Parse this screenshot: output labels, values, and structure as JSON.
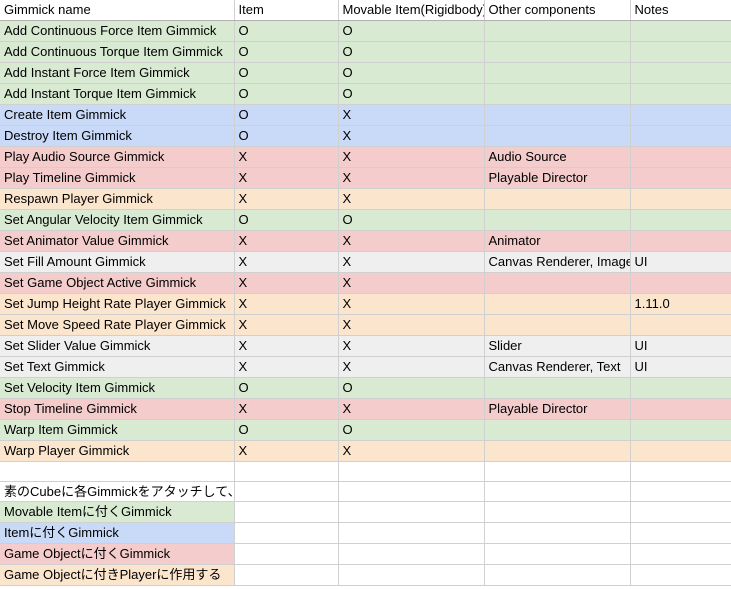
{
  "table": {
    "columns": [
      {
        "key": "gimmick_name",
        "label": "Gimmick name"
      },
      {
        "key": "item",
        "label": "Item"
      },
      {
        "key": "movable_item",
        "label": "Movable Item(Rigidbody)"
      },
      {
        "key": "other_components",
        "label": "Other components"
      },
      {
        "key": "notes",
        "label": "Notes"
      }
    ],
    "rows": [
      {
        "gimmick_name": "Add Continuous Force Item Gimmick",
        "item": "O",
        "movable_item": "O",
        "other_components": "",
        "notes": "",
        "fill": "green"
      },
      {
        "gimmick_name": "Add Continuous Torque Item Gimmick",
        "item": "O",
        "movable_item": "O",
        "other_components": "",
        "notes": "",
        "fill": "green"
      },
      {
        "gimmick_name": "Add Instant Force Item Gimmick",
        "item": "O",
        "movable_item": "O",
        "other_components": "",
        "notes": "",
        "fill": "green"
      },
      {
        "gimmick_name": "Add Instant Torque Item Gimmick",
        "item": "O",
        "movable_item": "O",
        "other_components": "",
        "notes": "",
        "fill": "green"
      },
      {
        "gimmick_name": "Create Item Gimmick",
        "item": "O",
        "movable_item": "X",
        "other_components": "",
        "notes": "",
        "fill": "blue"
      },
      {
        "gimmick_name": "Destroy Item Gimmick",
        "item": "O",
        "movable_item": "X",
        "other_components": "",
        "notes": "",
        "fill": "blue"
      },
      {
        "gimmick_name": "Play Audio Source Gimmick",
        "item": "X",
        "movable_item": "X",
        "other_components": "Audio Source",
        "notes": "",
        "fill": "pink"
      },
      {
        "gimmick_name": "Play Timeline Gimmick",
        "item": "X",
        "movable_item": "X",
        "other_components": "Playable Director",
        "notes": "",
        "fill": "pink"
      },
      {
        "gimmick_name": "Respawn Player Gimmick",
        "item": "X",
        "movable_item": "X",
        "other_components": "",
        "notes": "",
        "fill": "orange"
      },
      {
        "gimmick_name": "Set Angular Velocity Item Gimmick",
        "item": "O",
        "movable_item": "O",
        "other_components": "",
        "notes": "",
        "fill": "green"
      },
      {
        "gimmick_name": "Set Animator Value Gimmick",
        "item": "X",
        "movable_item": "X",
        "other_components": "Animator",
        "notes": "",
        "fill": "pink"
      },
      {
        "gimmick_name": "Set Fill Amount Gimmick",
        "item": "X",
        "movable_item": "X",
        "other_components": "Canvas Renderer, Image",
        "notes": "UI",
        "fill": "grey"
      },
      {
        "gimmick_name": "Set Game Object Active Gimmick",
        "item": "X",
        "movable_item": "X",
        "other_components": "",
        "notes": "",
        "fill": "pink"
      },
      {
        "gimmick_name": "Set Jump Height Rate Player Gimmick",
        "item": "X",
        "movable_item": "X",
        "other_components": "",
        "notes": "1.11.0",
        "fill": "orange"
      },
      {
        "gimmick_name": "Set Move Speed Rate Player Gimmick",
        "item": "X",
        "movable_item": "X",
        "other_components": "",
        "notes": "",
        "fill": "orange"
      },
      {
        "gimmick_name": "Set Slider Value Gimmick",
        "item": "X",
        "movable_item": "X",
        "other_components": "Slider",
        "notes": "UI",
        "fill": "grey"
      },
      {
        "gimmick_name": "Set Text Gimmick",
        "item": "X",
        "movable_item": "X",
        "other_components": "Canvas Renderer, Text",
        "notes": "UI",
        "fill": "grey"
      },
      {
        "gimmick_name": "Set Velocity Item Gimmick",
        "item": "O",
        "movable_item": "O",
        "other_components": "",
        "notes": "",
        "fill": "green"
      },
      {
        "gimmick_name": "Stop Timeline Gimmick",
        "item": "X",
        "movable_item": "X",
        "other_components": "Playable Director",
        "notes": "",
        "fill": "pink"
      },
      {
        "gimmick_name": "Warp Item Gimmick",
        "item": "O",
        "movable_item": "O",
        "other_components": "",
        "notes": "",
        "fill": "green"
      },
      {
        "gimmick_name": "Warp Player Gimmick",
        "item": "X",
        "movable_item": "X",
        "other_components": "",
        "notes": "",
        "fill": "orange"
      }
    ]
  },
  "caption": {
    "text": "素のCubeに各Gimmickをアタッチして、自動で付いたコンポーネントを確認した。"
  },
  "legend": {
    "items": [
      {
        "label": "Movable Itemに付くGimmick",
        "fill": "green"
      },
      {
        "label": "Itemに付くGimmick",
        "fill": "blue"
      },
      {
        "label": "Game Objectに付くGimmick",
        "fill": "pink"
      },
      {
        "label": "Game Objectに付きPlayerに作用する",
        "fill": "orange"
      }
    ]
  },
  "colors": {
    "green": "#d9ead3",
    "blue": "#c9daf8",
    "pink": "#f4cccc",
    "orange": "#fce5cd",
    "grey": "#efefef",
    "grid_line": "#d0d0d0"
  }
}
